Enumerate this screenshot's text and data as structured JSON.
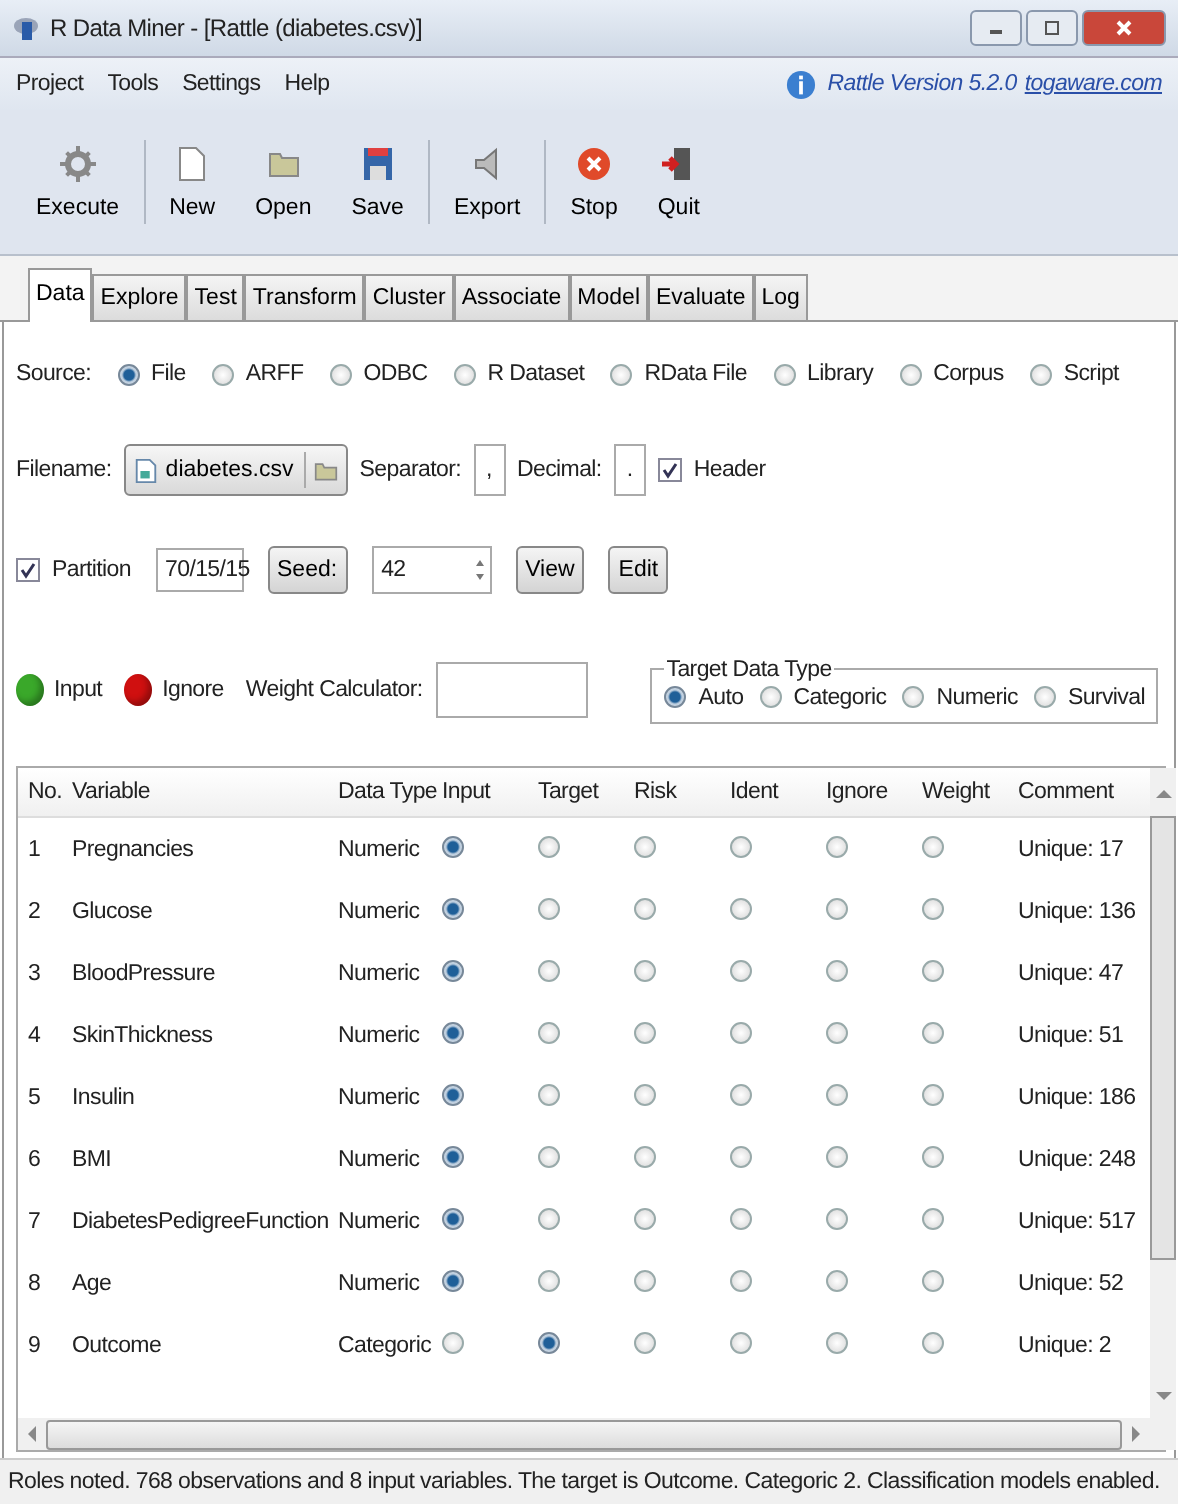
{
  "window": {
    "title": "R Data Miner - [Rattle (diabetes.csv)]"
  },
  "menu": [
    "Project",
    "Tools",
    "Settings",
    "Help"
  ],
  "version": {
    "text": "Rattle Version 5.2.0",
    "link": "togaware.com"
  },
  "toolbar": [
    {
      "label": "Execute",
      "kind": "execute"
    },
    {
      "label": "New",
      "kind": "new"
    },
    {
      "label": "Open",
      "kind": "open"
    },
    {
      "label": "Save",
      "kind": "save"
    },
    {
      "label": "Export",
      "kind": "export"
    },
    {
      "label": "Stop",
      "kind": "stop"
    },
    {
      "label": "Quit",
      "kind": "quit"
    }
  ],
  "tabs": [
    {
      "label": "Data",
      "selected": true
    },
    {
      "label": "Explore",
      "selected": false
    },
    {
      "label": "Test",
      "selected": false
    },
    {
      "label": "Transform",
      "selected": false
    },
    {
      "label": "Cluster",
      "selected": false
    },
    {
      "label": "Associate",
      "selected": false
    },
    {
      "label": "Model",
      "selected": false
    },
    {
      "label": "Evaluate",
      "selected": false
    },
    {
      "label": "Log",
      "selected": false
    }
  ],
  "source": {
    "label": "Source:",
    "options": [
      {
        "label": "File",
        "selected": true
      },
      {
        "label": "ARFF",
        "selected": false
      },
      {
        "label": "ODBC",
        "selected": false
      },
      {
        "label": "R Dataset",
        "selected": false
      },
      {
        "label": "RData File",
        "selected": false
      },
      {
        "label": "Library",
        "selected": false
      },
      {
        "label": "Corpus",
        "selected": false
      },
      {
        "label": "Script",
        "selected": false
      }
    ]
  },
  "filename": {
    "label": "Filename:",
    "value": "diabetes.csv",
    "separator_label": "Separator:",
    "separator": ",",
    "decimal_label": "Decimal:",
    "decimal": ".",
    "header_label": "Header",
    "header_checked": true
  },
  "partition": {
    "label": "Partition",
    "checked": true,
    "value": "70/15/15",
    "seed_button": "Seed:",
    "seed": "42",
    "view_button": "View",
    "edit_button": "Edit"
  },
  "legend": [
    {
      "label": "Input",
      "color": "#3aa82a"
    },
    {
      "label": "Ignore",
      "color": "#d01010"
    }
  ],
  "weight": {
    "label": "Weight Calculator:"
  },
  "target_type": {
    "title": "Target Data Type",
    "options": [
      {
        "label": "Auto",
        "selected": true
      },
      {
        "label": "Categoric",
        "selected": false
      },
      {
        "label": "Numeric",
        "selected": false
      },
      {
        "label": "Survival",
        "selected": false
      }
    ]
  },
  "table": {
    "columns": [
      {
        "label": "No.",
        "kind": "no"
      },
      {
        "label": "Variable",
        "kind": "variable"
      },
      {
        "label": "Data Type",
        "kind": "type"
      },
      {
        "label": "Input",
        "kind": "role"
      },
      {
        "label": "Target",
        "kind": "role"
      },
      {
        "label": "Risk",
        "kind": "role"
      },
      {
        "label": "Ident",
        "kind": "role"
      },
      {
        "label": "Ignore",
        "kind": "role"
      },
      {
        "label": "Weight",
        "kind": "role"
      },
      {
        "label": "Comment",
        "kind": "comment"
      }
    ],
    "rows": [
      {
        "no": "1",
        "variable": "Pregnancies",
        "type": "Numeric",
        "roles": [
          {
            "selected": true
          },
          {
            "selected": false
          },
          {
            "selected": false
          },
          {
            "selected": false
          },
          {
            "selected": false
          },
          {
            "selected": false
          }
        ],
        "comment": "Unique: 17"
      },
      {
        "no": "2",
        "variable": "Glucose",
        "type": "Numeric",
        "roles": [
          {
            "selected": true
          },
          {
            "selected": false
          },
          {
            "selected": false
          },
          {
            "selected": false
          },
          {
            "selected": false
          },
          {
            "selected": false
          }
        ],
        "comment": "Unique: 136"
      },
      {
        "no": "3",
        "variable": "BloodPressure",
        "type": "Numeric",
        "roles": [
          {
            "selected": true
          },
          {
            "selected": false
          },
          {
            "selected": false
          },
          {
            "selected": false
          },
          {
            "selected": false
          },
          {
            "selected": false
          }
        ],
        "comment": "Unique: 47"
      },
      {
        "no": "4",
        "variable": "SkinThickness",
        "type": "Numeric",
        "roles": [
          {
            "selected": true
          },
          {
            "selected": false
          },
          {
            "selected": false
          },
          {
            "selected": false
          },
          {
            "selected": false
          },
          {
            "selected": false
          }
        ],
        "comment": "Unique: 51"
      },
      {
        "no": "5",
        "variable": "Insulin",
        "type": "Numeric",
        "roles": [
          {
            "selected": true
          },
          {
            "selected": false
          },
          {
            "selected": false
          },
          {
            "selected": false
          },
          {
            "selected": false
          },
          {
            "selected": false
          }
        ],
        "comment": "Unique: 186"
      },
      {
        "no": "6",
        "variable": "BMI",
        "type": "Numeric",
        "roles": [
          {
            "selected": true
          },
          {
            "selected": false
          },
          {
            "selected": false
          },
          {
            "selected": false
          },
          {
            "selected": false
          },
          {
            "selected": false
          }
        ],
        "comment": "Unique: 248"
      },
      {
        "no": "7",
        "variable": "DiabetesPedigreeFunction",
        "type": "Numeric",
        "roles": [
          {
            "selected": true
          },
          {
            "selected": false
          },
          {
            "selected": false
          },
          {
            "selected": false
          },
          {
            "selected": false
          },
          {
            "selected": false
          }
        ],
        "comment": "Unique: 517"
      },
      {
        "no": "8",
        "variable": "Age",
        "type": "Numeric",
        "roles": [
          {
            "selected": true
          },
          {
            "selected": false
          },
          {
            "selected": false
          },
          {
            "selected": false
          },
          {
            "selected": false
          },
          {
            "selected": false
          }
        ],
        "comment": "Unique: 52"
      },
      {
        "no": "9",
        "variable": "Outcome",
        "type": "Categoric",
        "roles": [
          {
            "selected": false
          },
          {
            "selected": true
          },
          {
            "selected": false
          },
          {
            "selected": false
          },
          {
            "selected": false
          },
          {
            "selected": false
          }
        ],
        "comment": "Unique: 2"
      }
    ]
  },
  "status_bar": "Roles noted. 768 observations and 8 input variables. The target is Outcome. Categoric 2. Classification models enabled."
}
